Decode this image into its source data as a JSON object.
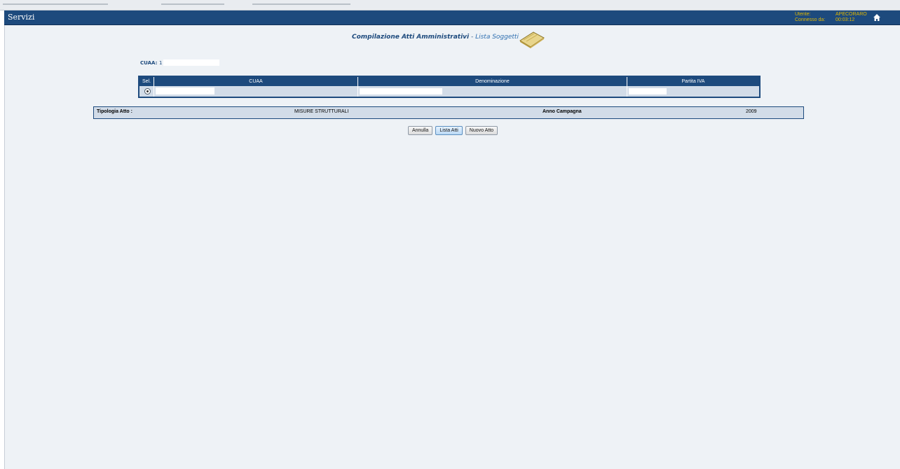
{
  "header": {
    "title": "Servizi",
    "user_label": "Utente:",
    "user_value": "APECORARO",
    "connected_label": "Connesso da:",
    "connected_value": "00:03:12",
    "home_icon": "home-icon"
  },
  "page": {
    "title_main": "Compilazione Atti Amministrativi",
    "title_sep": " - ",
    "title_sub": "Lista Soggetti",
    "title_icon": "book-icon"
  },
  "cuaa": {
    "label": "CUAA:",
    "value": "1"
  },
  "soggetti_table": {
    "columns": [
      "Sel.",
      "CUAA",
      "Denominazione",
      "Partita IVA"
    ],
    "rows": [
      {
        "selected": true
      }
    ]
  },
  "tipologia": {
    "label": "Tipologia Atto :",
    "value": "MISURE STRUTTURALI",
    "anno_label": "Anno Campagna",
    "anno_value": "2009"
  },
  "buttons": {
    "annulla": "Annulla",
    "lista_atti": "Lista Atti",
    "nuovo_atto": "Nuovo Atto"
  },
  "colors": {
    "header_bg": "#1d4a7d",
    "content_bg": "#eef2f6",
    "row_bg": "#d2dce8",
    "user_text": "#e1b700"
  }
}
